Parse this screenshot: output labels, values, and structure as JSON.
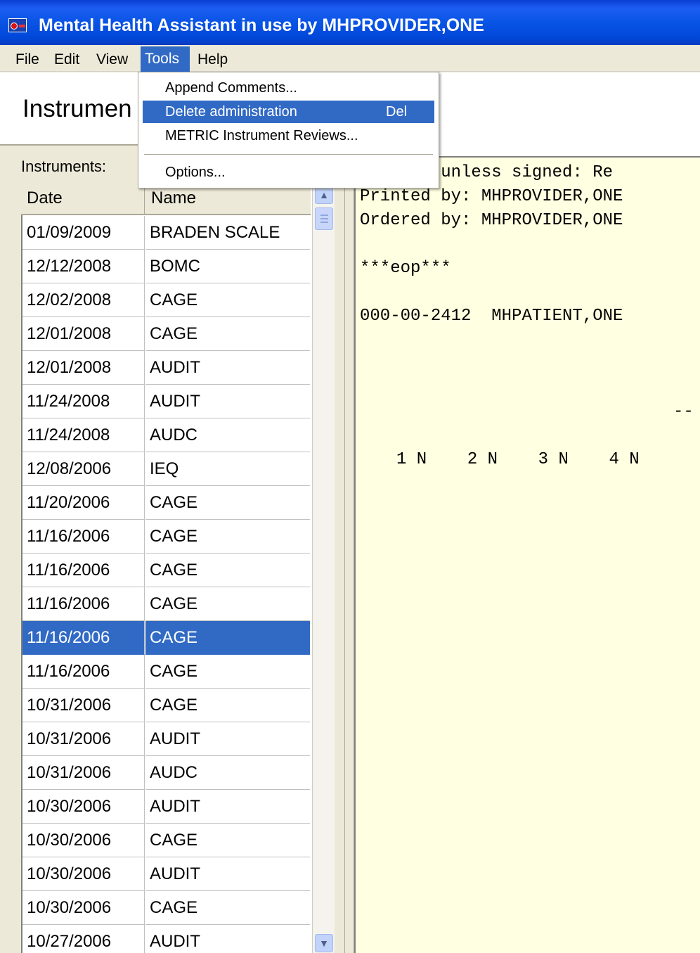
{
  "window": {
    "title": "Mental Health Assistant in use by MHPROVIDER,ONE"
  },
  "menubar": {
    "file": "File",
    "edit": "Edit",
    "view": "View",
    "tools": "Tools",
    "help": "Help"
  },
  "tools_menu": {
    "append_comments": "Append Comments...",
    "delete_administration": "Delete administration",
    "delete_shortcut": "Del",
    "metric_reviews": "METRIC Instrument Reviews...",
    "options": "Options..."
  },
  "heading": "Instrumen",
  "instruments": {
    "label": "Instruments:",
    "columns": {
      "date": "Date",
      "name": "Name"
    },
    "rows": [
      {
        "date": "01/09/2009",
        "name": "BRADEN SCALE"
      },
      {
        "date": "12/12/2008",
        "name": "BOMC"
      },
      {
        "date": "12/02/2008",
        "name": "CAGE"
      },
      {
        "date": "12/01/2008",
        "name": "CAGE"
      },
      {
        "date": "12/01/2008",
        "name": "AUDIT"
      },
      {
        "date": "11/24/2008",
        "name": "AUDIT"
      },
      {
        "date": "11/24/2008",
        "name": "AUDC"
      },
      {
        "date": "12/08/2006",
        "name": "IEQ"
      },
      {
        "date": "11/20/2006",
        "name": "CAGE"
      },
      {
        "date": "11/16/2006",
        "name": "CAGE"
      },
      {
        "date": "11/16/2006",
        "name": "CAGE"
      },
      {
        "date": "11/16/2006",
        "name": "CAGE"
      },
      {
        "date": "11/16/2006",
        "name": "CAGE"
      },
      {
        "date": "11/16/2006",
        "name": "CAGE"
      },
      {
        "date": "10/31/2006",
        "name": "CAGE"
      },
      {
        "date": "10/31/2006",
        "name": "AUDIT"
      },
      {
        "date": "10/31/2006",
        "name": "AUDC"
      },
      {
        "date": "10/30/2006",
        "name": "AUDIT"
      },
      {
        "date": "10/30/2006",
        "name": "CAGE"
      },
      {
        "date": "10/30/2006",
        "name": "AUDIT"
      },
      {
        "date": "10/30/2006",
        "name": "CAGE"
      },
      {
        "date": "10/27/2006",
        "name": "AUDIT"
      }
    ]
  },
  "report": {
    "lines": [
      "    lid unless signed: Re",
      "Printed by: MHPROVIDER,ONE",
      "Ordered by: MHPROVIDER,ONE",
      "***eop***",
      "000-00-2412  MHPATIENT,ONE",
      "--",
      "1 N    2 N    3 N    4 N"
    ]
  }
}
